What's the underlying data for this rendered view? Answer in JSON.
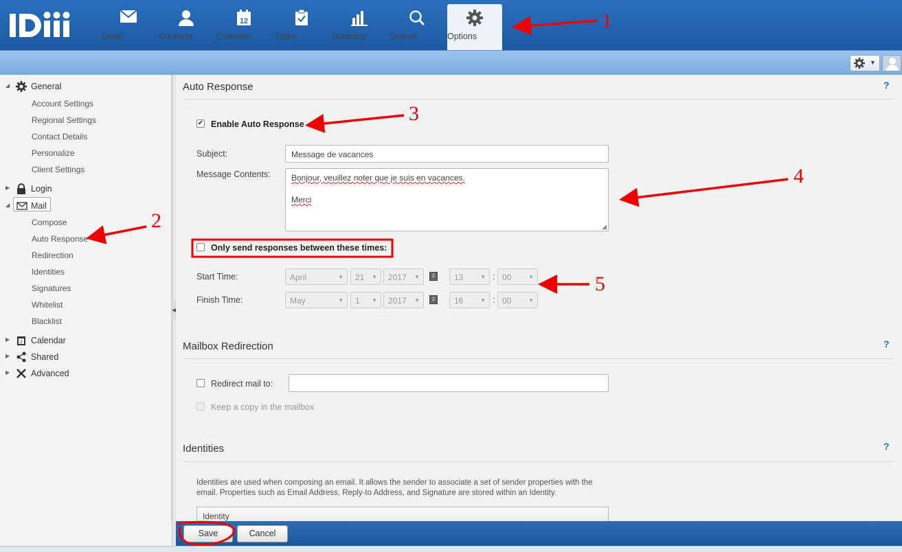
{
  "app": {
    "logo_text": "IDIIi"
  },
  "nav": {
    "items": [
      {
        "label": "Email",
        "icon": "envelope-icon"
      },
      {
        "label": "Contacts",
        "icon": "person-icon"
      },
      {
        "label": "Calendar",
        "icon": "calendar-icon",
        "icon_text": "12"
      },
      {
        "label": "Tasks",
        "icon": "clipboard-check-icon"
      },
      {
        "label": "Statistics",
        "icon": "bar-chart-icon"
      },
      {
        "label": "Search",
        "icon": "search-icon"
      },
      {
        "label": "Options",
        "icon": "gear-icon",
        "active": true
      }
    ]
  },
  "sidebar": {
    "general": {
      "label": "General",
      "items": [
        "Account Settings",
        "Regional Settings",
        "Contact Details",
        "Personalize",
        "Client Settings"
      ]
    },
    "login": {
      "label": "Login"
    },
    "mail": {
      "label": "Mail",
      "items": [
        "Compose",
        "Auto Response",
        "Redirection",
        "Identities",
        "Signatures",
        "Whitelist",
        "Blacklist"
      ]
    },
    "calendar": {
      "label": "Calendar",
      "icon_text": "2"
    },
    "shared": {
      "label": "Shared"
    },
    "advanced": {
      "label": "Advanced"
    }
  },
  "auto_response": {
    "title": "Auto Response",
    "help": "?",
    "enable_label": "Enable Auto Response",
    "enable_checked": true,
    "subject_label": "Subject:",
    "subject_value": "Message de vacances",
    "message_label": "Message Contents:",
    "message_lines": [
      "Bonjour, veuillez noter que je suis en vacances.",
      "",
      "Merci"
    ],
    "only_times_label": "Only send responses between these times:",
    "only_times_checked": false,
    "start_label": "Start Time:",
    "start": {
      "month": "April",
      "day": "21",
      "year": "2017",
      "hour": "13",
      "minute": "00"
    },
    "finish_label": "Finish Time:",
    "finish": {
      "month": "May",
      "day": "1",
      "year": "2017",
      "hour": "16",
      "minute": "00"
    },
    "calendar_icon_text": "2",
    "time_sep": ":"
  },
  "redirection": {
    "title": "Mailbox Redirection",
    "help": "?",
    "redirect_label": "Redirect mail to:",
    "redirect_value": "",
    "keep_copy_label": "Keep a copy in the mailbox"
  },
  "identities": {
    "title": "Identities",
    "help": "?",
    "description": "Identities are used when composing an email. It allows the sender to associate a set of sender properties with the email. Properties such as Email Address, Reply-to Address, and Signature are stored within an Identity.",
    "list_header": "Identity"
  },
  "footer": {
    "save_label": "Save",
    "cancel_label": "Cancel"
  },
  "annotations": {
    "n1": "1",
    "n2": "2",
    "n3": "3",
    "n4": "4",
    "n5": "5",
    "color": "#e00000"
  }
}
